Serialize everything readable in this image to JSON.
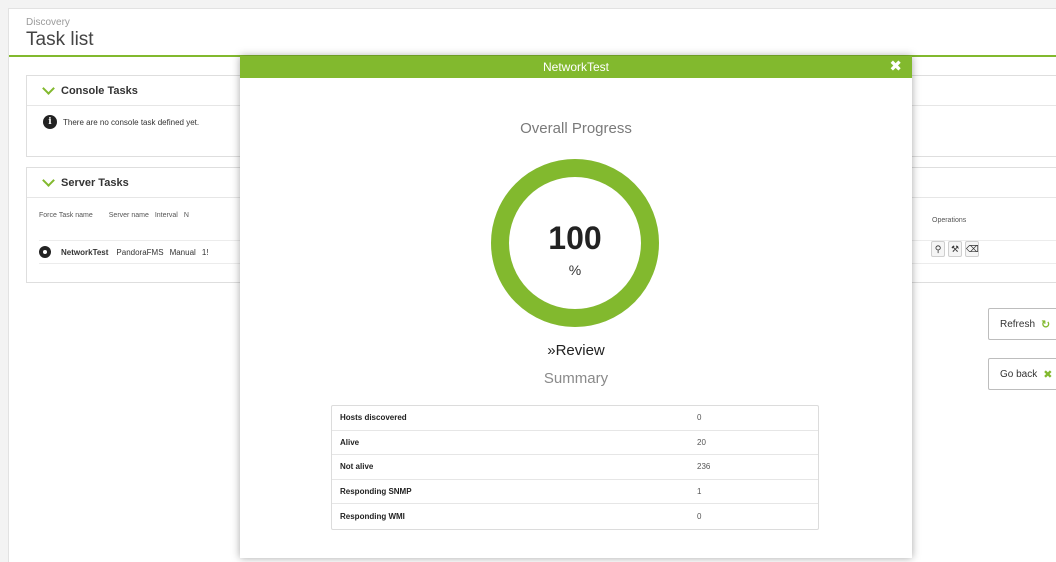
{
  "header": {
    "breadcrumb": "Discovery",
    "title": "Task list"
  },
  "console_tasks": {
    "title": "Console Tasks",
    "info": "There are no console task defined yet."
  },
  "server_tasks": {
    "title": "Server Tasks",
    "columns": [
      "Force",
      "Task name",
      "Server name",
      "Interval",
      "N"
    ],
    "operations_label": "Operations",
    "row": {
      "task_name": "NetworkTest",
      "server_name": "PandoraFMS",
      "interval": "Manual",
      "next": "1!"
    }
  },
  "buttons": {
    "refresh": "Refresh",
    "go_back": "Go back"
  },
  "modal": {
    "title": "NetworkTest",
    "overall_progress_label": "Overall Progress",
    "progress_value": "100",
    "progress_unit": "%",
    "progress_fraction": 1.0,
    "review_label": "»Review",
    "summary_label": "Summary",
    "summary_rows": [
      {
        "label": "Hosts discovered",
        "value": "0"
      },
      {
        "label": "Alive",
        "value": "20"
      },
      {
        "label": "Not alive",
        "value": "236"
      },
      {
        "label": "Responding SNMP",
        "value": "1"
      },
      {
        "label": "Responding WMI",
        "value": "0"
      }
    ]
  },
  "colors": {
    "accent": "#82b92e"
  }
}
